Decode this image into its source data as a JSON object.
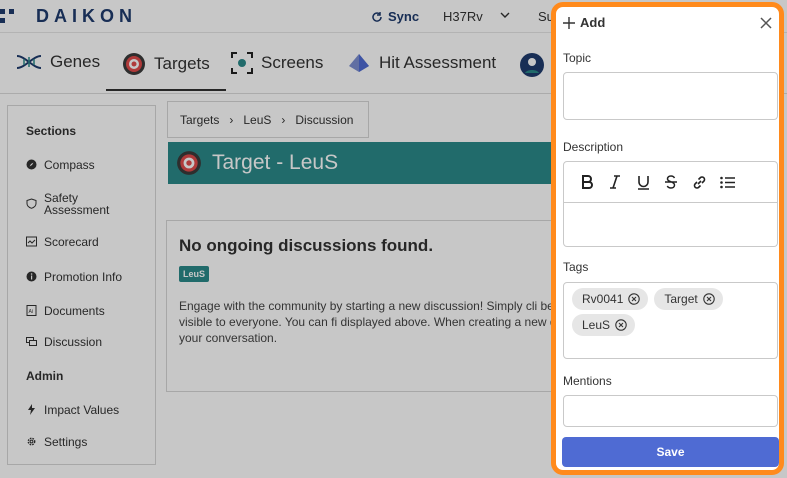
{
  "header": {
    "brand": "DAIKON",
    "sync_label": "Sync",
    "strain": "H37Rv",
    "user_partial": "Su"
  },
  "tabs": [
    {
      "label": "Genes",
      "icon": "dna-icon"
    },
    {
      "label": "Targets",
      "icon": "target-icon",
      "active": true
    },
    {
      "label": "Screens",
      "icon": "screen-icon"
    },
    {
      "label": "Hit Assessment",
      "icon": "flask-icon"
    }
  ],
  "sidebar": {
    "sections_heading": "Sections",
    "items": [
      {
        "label": "Compass",
        "icon": "compass-icon"
      },
      {
        "label": "Safety Assessment",
        "icon": "shield-icon"
      },
      {
        "label": "Scorecard",
        "icon": "scorecard-icon"
      },
      {
        "label": "Promotion Info",
        "icon": "info-icon"
      },
      {
        "label": "Documents",
        "icon": "document-icon"
      },
      {
        "label": "Discussion",
        "icon": "chat-icon"
      }
    ],
    "admin_heading": "Admin",
    "admin_items": [
      {
        "label": "Impact Values",
        "icon": "bolt-icon"
      },
      {
        "label": "Settings",
        "icon": "gear-icon"
      }
    ]
  },
  "breadcrumb": [
    "Targets",
    "LeuS",
    "Discussion"
  ],
  "page_title": "Target - LeuS",
  "panel": {
    "heading": "No ongoing discussions found.",
    "tag": "LeuS",
    "body": "Engage with the community by starting a new discussion! Simply cli begin. Keep in mind that discussions visible to everyone. You can fi displayed above. When creating a new discussion, be sure to add re join your conversation."
  },
  "drawer": {
    "title": "Add",
    "topic_label": "Topic",
    "topic_value": "",
    "description_label": "Description",
    "description_value": "",
    "toolbar": [
      "bold",
      "italic",
      "underline",
      "strikethrough",
      "link",
      "bullet-list"
    ],
    "tags_label": "Tags",
    "tags": [
      "Rv0041",
      "Target",
      "LeuS"
    ],
    "mentions_label": "Mentions",
    "mentions_value": "",
    "save_label": "Save"
  },
  "colors": {
    "accent": "#2b8a8a",
    "brand": "#1f3b6d",
    "save": "#4f6bd3",
    "highlight": "#ff8a1c"
  }
}
